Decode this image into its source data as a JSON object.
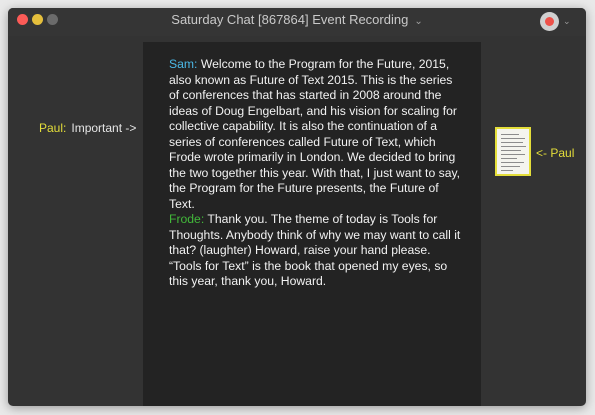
{
  "window": {
    "title": "Saturday Chat [867864] Event Recording",
    "title_chevron": "⌄",
    "record_chevron": "⌄"
  },
  "colors": {
    "speaker_sam": "#4bb8e6",
    "speaker_frode": "#42b83a",
    "annotation": "#e4de3a",
    "record": "#ee5149"
  },
  "transcript": [
    {
      "speaker": "Sam:",
      "text": " Welcome to the Program for the Future, 2015, also known as Future of Text 2015. This is the series of conferences that has started in 2008 around the ideas of Doug Engelbart, and his vision for scaling for collective capability. It is also the continuation of a series of conferences called Future of Text, which Frode wrote primarily in London. We decided to bring the two together this year. With that, I just want to say, the Program for the Future presents, the Future of Text."
    },
    {
      "speaker": "Frode:",
      "text": " Thank you. The theme of today is Tools for Thoughts. Anybody think of why we may want to call it that? (laughter) Howard, raise your hand please. “Tools for Text” is the book that opened my eyes, so this year, thank you, Howard."
    }
  ],
  "annotations": {
    "left_speaker": "Paul:",
    "left_text": "Important ->",
    "right_text": "<- Paul",
    "document_icon": "document-thumbnail-icon"
  }
}
